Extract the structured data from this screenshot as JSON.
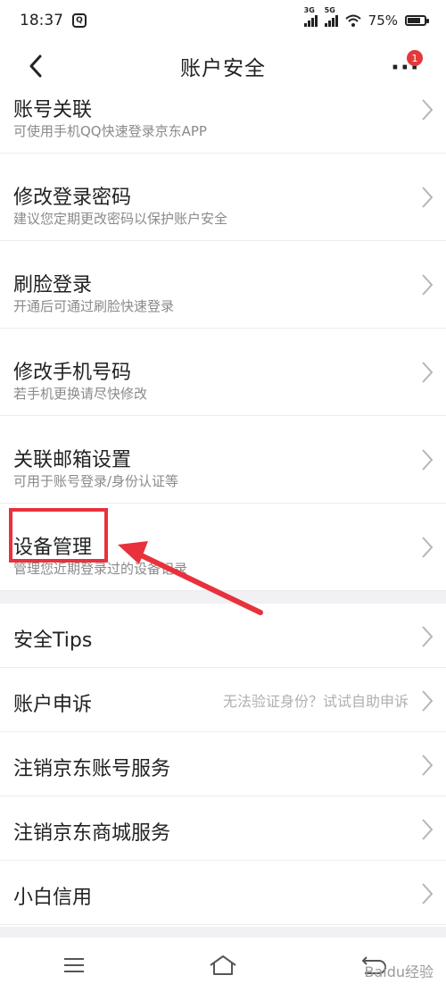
{
  "status_bar": {
    "time": "18:37",
    "app_icon": "Q",
    "signal1": "3G",
    "signal2": "5G",
    "battery_text": "75%",
    "battery_level": 0.75
  },
  "nav": {
    "title": "账户安全",
    "badge_count": "1",
    "back_icon": "chevron-left-icon",
    "more_icon": "more-dots-icon"
  },
  "section1": [
    {
      "title": "账号关联",
      "subtitle": "可使用手机QQ快速登录京东APP"
    },
    {
      "title": "修改登录密码",
      "subtitle": "建议您定期更改密码以保护账户安全"
    },
    {
      "title": "刷脸登录",
      "subtitle": "开通后可通过刷脸快速登录"
    },
    {
      "title": "修改手机号码",
      "subtitle": "若手机更换请尽快修改"
    },
    {
      "title": "关联邮箱设置",
      "subtitle": "可用于账号登录/身份认证等"
    },
    {
      "title": "设备管理",
      "subtitle": "管理您近期登录过的设备记录"
    }
  ],
  "section2": [
    {
      "title": "安全Tips",
      "hint": ""
    },
    {
      "title": "账户申诉",
      "hint": "无法验证身份？试试自助申诉"
    },
    {
      "title": "注销京东账号服务",
      "hint": ""
    },
    {
      "title": "注销京东商城服务",
      "hint": ""
    },
    {
      "title": "小白信用",
      "hint": ""
    }
  ],
  "watermark": "Baidu经验",
  "colors": {
    "accent": "#e8313c",
    "badge": "#e4393c"
  }
}
